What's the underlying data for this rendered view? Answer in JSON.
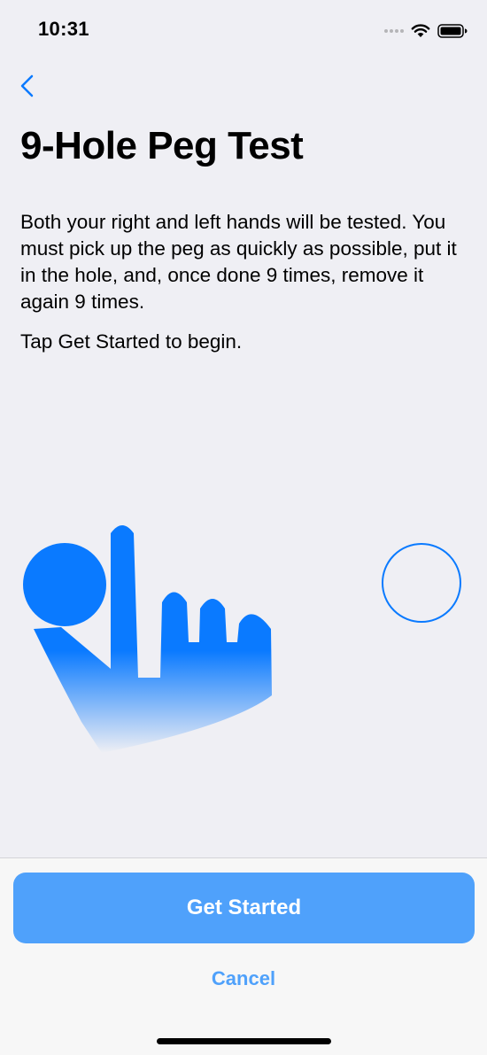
{
  "status_bar": {
    "time": "10:31"
  },
  "nav": {
    "back_icon": "chevron-left-icon"
  },
  "content": {
    "title": "9-Hole Peg Test",
    "instructions": "Both your right and left hands will be tested. You must pick up the peg as quickly as possible, put it in the hole, and, once done 9 times, remove it again 9 times.",
    "tap_prompt": "Tap Get Started to begin."
  },
  "illustration": {
    "hand_icon": "hand-with-peg-icon",
    "hole_icon": "peg-hole-icon"
  },
  "footer": {
    "primary_label": "Get Started",
    "secondary_label": "Cancel"
  },
  "colors": {
    "accent": "#0a7aff",
    "button_fill": "#4fa1fb",
    "background": "#efeff4",
    "footer": "#f7f7f7"
  }
}
